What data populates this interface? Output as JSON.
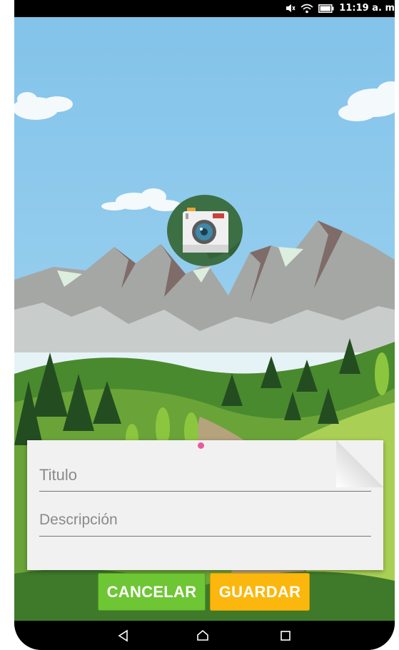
{
  "status_bar": {
    "time": "11:19 a. m",
    "icons": [
      "mute-icon",
      "wifi-icon",
      "battery-icon"
    ]
  },
  "camera_button": {
    "icon": "camera-icon"
  },
  "form": {
    "title_placeholder": "Titulo",
    "description_placeholder": "Descripción"
  },
  "actions": {
    "cancel_label": "CANCELAR",
    "save_label": "GUARDAR"
  },
  "nav_bar": {
    "icons": [
      "back-icon",
      "home-icon",
      "recents-icon"
    ]
  },
  "colors": {
    "sky": "#87c6ea",
    "cancel": "#6ec634",
    "save": "#fbb70d",
    "camera_bg": "#3c6f43",
    "pin": "#e85b9b"
  }
}
